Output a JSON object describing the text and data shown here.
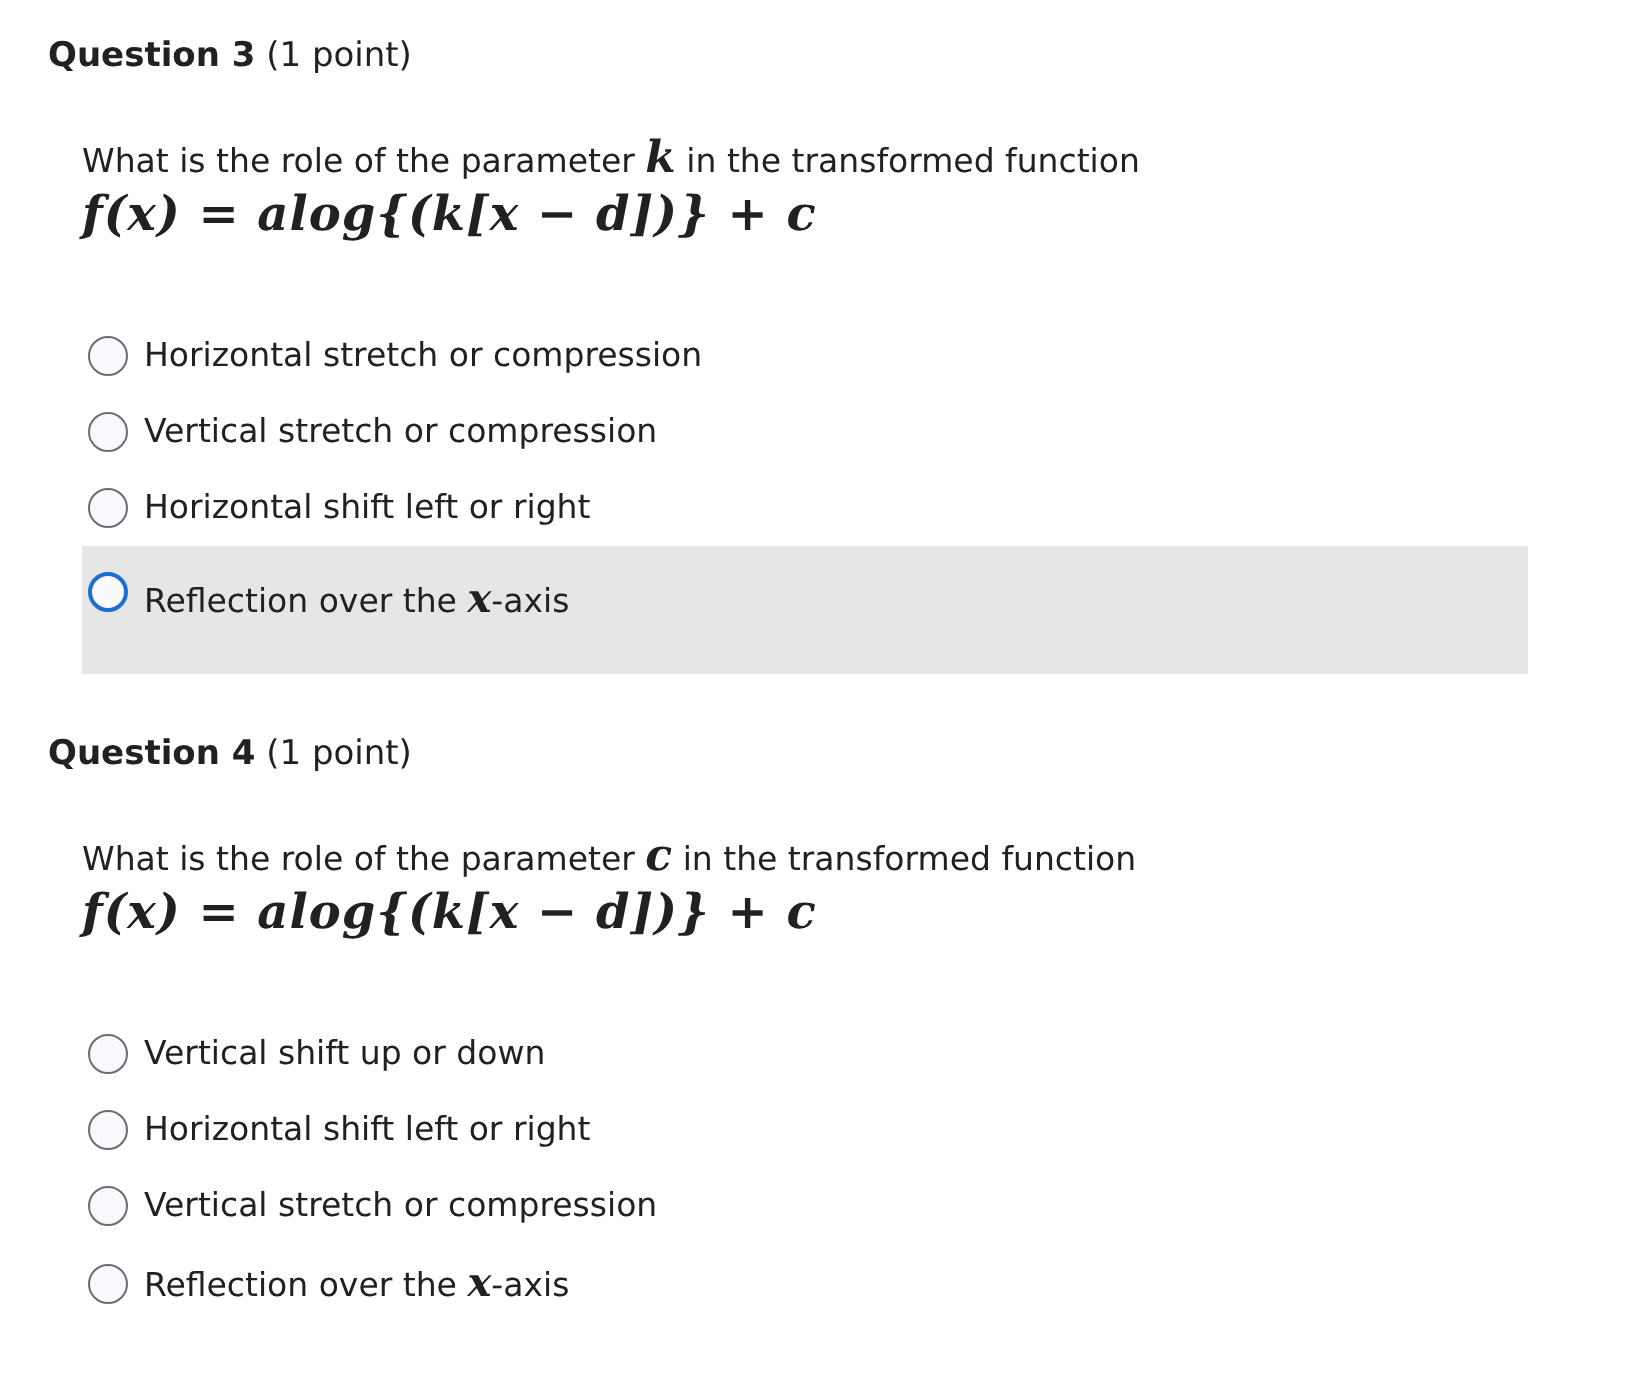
{
  "questions": [
    {
      "heading": "**Question 3** (1 point)",
      "prompt": "What is the role of the parameter **k** in the transformed function",
      "formula": "f(x) = alog{(k[x − d])} + c",
      "options": [
        {
          "label": "Horizontal stretch or compression",
          "selected": false,
          "highlighted": false
        },
        {
          "label": "Vertical stretch or compression",
          "selected": false,
          "highlighted": false
        },
        {
          "label": "Horizontal shift left or right",
          "selected": false,
          "highlighted": false
        },
        {
          "label": "Reflection over the **x**-axis",
          "selected": false,
          "highlighted": true
        }
      ]
    },
    {
      "heading": "**Question 4** (1 point)",
      "prompt": "What is the role of the parameter **c** in the transformed function",
      "formula": "f(x) = alog{(k[x − d])} + c",
      "options": [
        {
          "label": "Vertical shift up or down",
          "selected": false,
          "highlighted": false
        },
        {
          "label": "Horizontal shift left or right",
          "selected": false,
          "highlighted": false
        },
        {
          "label": "Vertical stretch or compression",
          "selected": false,
          "highlighted": false
        },
        {
          "label": "Reflection over the **x**-axis",
          "selected": false,
          "highlighted": false
        }
      ]
    }
  ]
}
